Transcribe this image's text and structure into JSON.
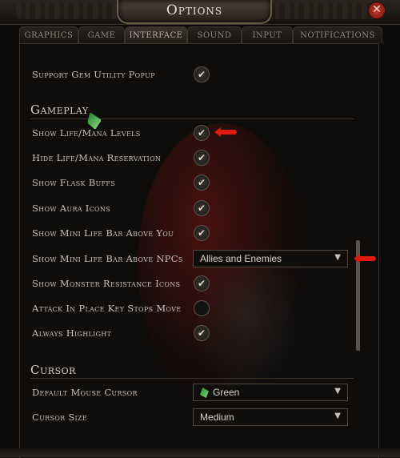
{
  "window": {
    "title": "Options",
    "close_symbol": "✕"
  },
  "tabs": [
    {
      "label": "Graphics",
      "active": false
    },
    {
      "label": "Game",
      "active": false
    },
    {
      "label": "Interface",
      "active": true
    },
    {
      "label": "Sound",
      "active": false
    },
    {
      "label": "Input",
      "active": false
    },
    {
      "label": "Notifications",
      "active": false
    }
  ],
  "top_rows": [
    {
      "label": "Support Gem Utility Popup",
      "checked": true
    }
  ],
  "gameplay": {
    "heading": "Gameplay",
    "rows": [
      {
        "label": "Show Life/Mana Levels",
        "checked": true
      },
      {
        "label": "Hide Life/Mana Reservation",
        "checked": true
      },
      {
        "label": "Show Flask Buffs",
        "checked": true
      },
      {
        "label": "Show Aura Icons",
        "checked": true
      },
      {
        "label": "Show Mini Life Bar Above You",
        "checked": true
      },
      {
        "label": "Show Mini Life Bar Above NPCs",
        "dropdown": "Allies and Enemies"
      },
      {
        "label": "Show Monster Resistance Icons",
        "checked": true
      },
      {
        "label": "Attack In Place Key Stops Move",
        "checked": false
      },
      {
        "label": "Always Highlight",
        "checked": true
      }
    ]
  },
  "cursor": {
    "heading": "Cursor",
    "rows": [
      {
        "label": "Default Mouse Cursor",
        "dropdown": "Green"
      },
      {
        "label": "Cursor Size",
        "dropdown": "Medium"
      }
    ]
  },
  "glyphs": {
    "check": "✔",
    "dropdown_arrow": "▼"
  },
  "colors": {
    "annotation_arrow": "#e01a10",
    "gem_green": "#4fb04a"
  }
}
